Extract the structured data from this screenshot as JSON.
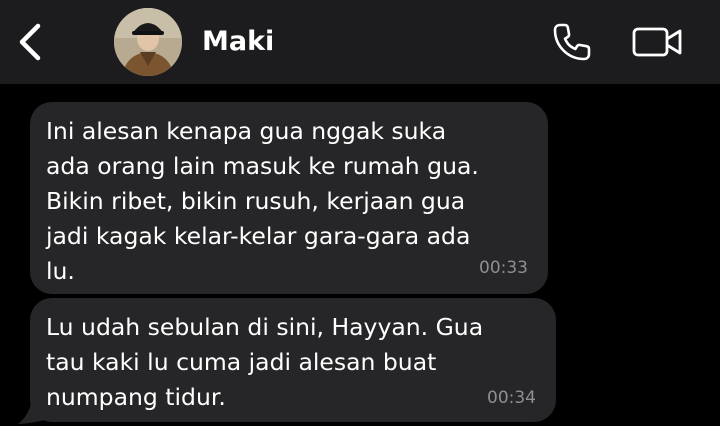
{
  "header": {
    "contact_name": "Maki",
    "back_icon": "chevron-left-icon",
    "call_icon": "phone-icon",
    "video_icon": "video-camera-icon"
  },
  "messages": [
    {
      "text": "Ini alesan kenapa gua nggak suka\nada orang lain masuk ke rumah gua.\nBikin ribet, bikin rusuh, kerjaan gua\njadi kagak kelar-kelar gara-gara ada\nlu.",
      "time": "00:33"
    },
    {
      "text": "Lu udah sebulan di sini, Hayyan. Gua\ntau kaki lu cuma jadi alesan buat\nnumpang tidur.",
      "time": "00:34"
    }
  ],
  "colors": {
    "background": "#000000",
    "header": "#1c1c1e",
    "bubble": "#262628",
    "timestamp": "#8e8e93",
    "text": "#ffffff"
  }
}
